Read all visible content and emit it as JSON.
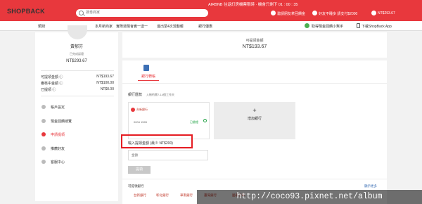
{
  "header": {
    "logo": "SHOPBACK",
    "search_placeholder": "搜尋商家",
    "promo": "AIRBNB 往返訂房機票限時 · 機會只剩下 01 : 00 : 35",
    "links": {
      "refer": "邀請朋友拿回饋金",
      "cashback": "好友不睡多 請支付$2000",
      "balance": "NT$293.67"
    }
  },
  "nav": {
    "category": "類別",
    "items": [
      "本月新商家",
      "實際適現會實一送一",
      "進出至4次活動報",
      "銀行優惠"
    ],
    "extension": "取得現金回饋小幫手",
    "app": "下載ShopBack App"
  },
  "sidebar": {
    "name": "黃郁芬",
    "verified": "已完成認證",
    "amount": "NT$293.67",
    "rows": [
      {
        "label": "可提領金額 ⓘ",
        "value": "NT$193.67"
      },
      {
        "label": "審核中金額 ⓘ",
        "value": "NT$100.00"
      },
      {
        "label": "已提領 ⓘ",
        "value": "NT$0.00"
      }
    ],
    "menu": [
      "帳戶設定",
      "現金回饋總覽",
      "申請提領",
      "推薦好友",
      "客服中心"
    ]
  },
  "main": {
    "withdrawable_label": "可提領金額",
    "withdrawable_value": "NT$193.67",
    "tab": "銀行轉帳",
    "transfer_title": "銀行匯款",
    "transfer_note": "入帳約需7-14個工作天",
    "bank_name": "台新銀行",
    "bank_account": "0004 1528",
    "bank_status": "已驗證",
    "add_bank": "增加銀行",
    "amount_label": "輸入提領金額 (最少 NT$200)",
    "amount_placeholder": "金額",
    "submit": "提領",
    "partners_label": "可提領銀行",
    "partners_more": "顯示更多",
    "partners": [
      "台新銀行",
      "彰化銀行",
      "華南銀行",
      "臺灣銀行",
      "國泰世華"
    ]
  },
  "watermark": "http://coco93.pixnet.net/album"
}
